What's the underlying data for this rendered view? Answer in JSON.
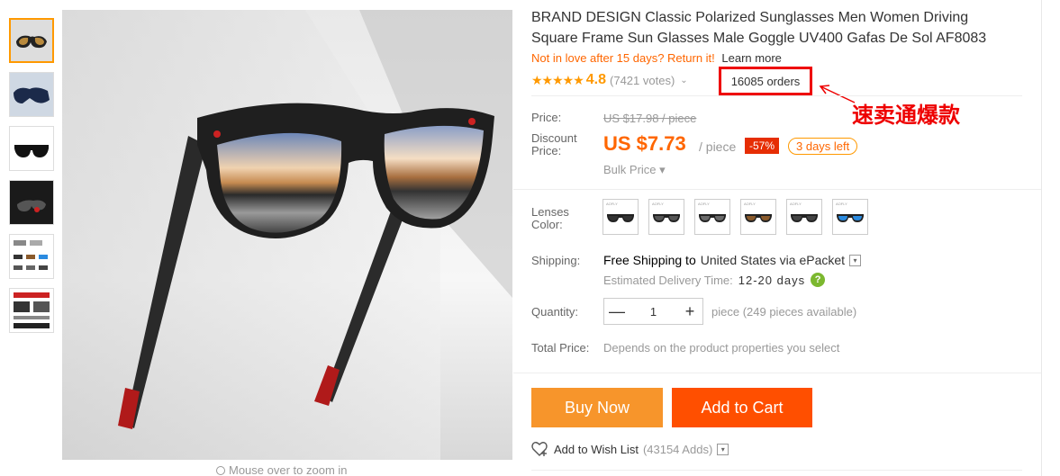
{
  "product": {
    "title": "BRAND DESIGN Classic Polarized Sunglasses Men Women Driving Square Frame Sun Glasses Male Goggle UV400 Gafas De Sol AF8083",
    "returns_text": "Not in love after 15 days? Return it!",
    "learn_more": "Learn more",
    "stars": "★★★★★",
    "rating": "4.8",
    "votes": "(7421 votes)",
    "orders": "16085 orders",
    "annotation": "速卖通爆款"
  },
  "pricing": {
    "price_label": "Price:",
    "old_price": "US $17.98 / piece",
    "discount_label_1": "Discount",
    "discount_label_2": "Price:",
    "new_price": "US $7.73",
    "per_piece": "/ piece",
    "discount": "-57%",
    "days_left": "3 days left",
    "bulk_price": "Bulk Price ▾"
  },
  "options": {
    "lenses_label_1": "Lenses",
    "lenses_label_2": "Color:",
    "swatch_brand": "AOFLY",
    "swatches": [
      {
        "lens": "#333333"
      },
      {
        "lens": "#555555"
      },
      {
        "lens": "#6a6a6a"
      },
      {
        "lens": "#8a5a2b"
      },
      {
        "lens": "#444444"
      },
      {
        "lens": "#2b8be0"
      }
    ]
  },
  "shipping": {
    "label": "Shipping:",
    "free": "Free Shipping to",
    "destination": "United States via ePacket",
    "delivery_label": "Estimated Delivery Time:",
    "delivery_days": "12-20 days",
    "help": "?"
  },
  "quantity": {
    "label": "Quantity:",
    "minus": "—",
    "value": "1",
    "plus": "+",
    "available": "piece (249 pieces available)"
  },
  "total": {
    "label": "Total Price:",
    "note": "Depends on the product properties you select"
  },
  "actions": {
    "buy_now": "Buy Now",
    "add_to_cart": "Add to Cart",
    "wishlist": "Add to Wish List",
    "wishlist_count": "(43154 Adds)"
  },
  "gallery": {
    "zoom_hint": "Mouse over to zoom in"
  },
  "colors": {
    "accent_orange": "#ff6600",
    "buy_button": "#f7952b",
    "cart_button": "#ff4f00",
    "annotation_red": "#ee0000"
  }
}
